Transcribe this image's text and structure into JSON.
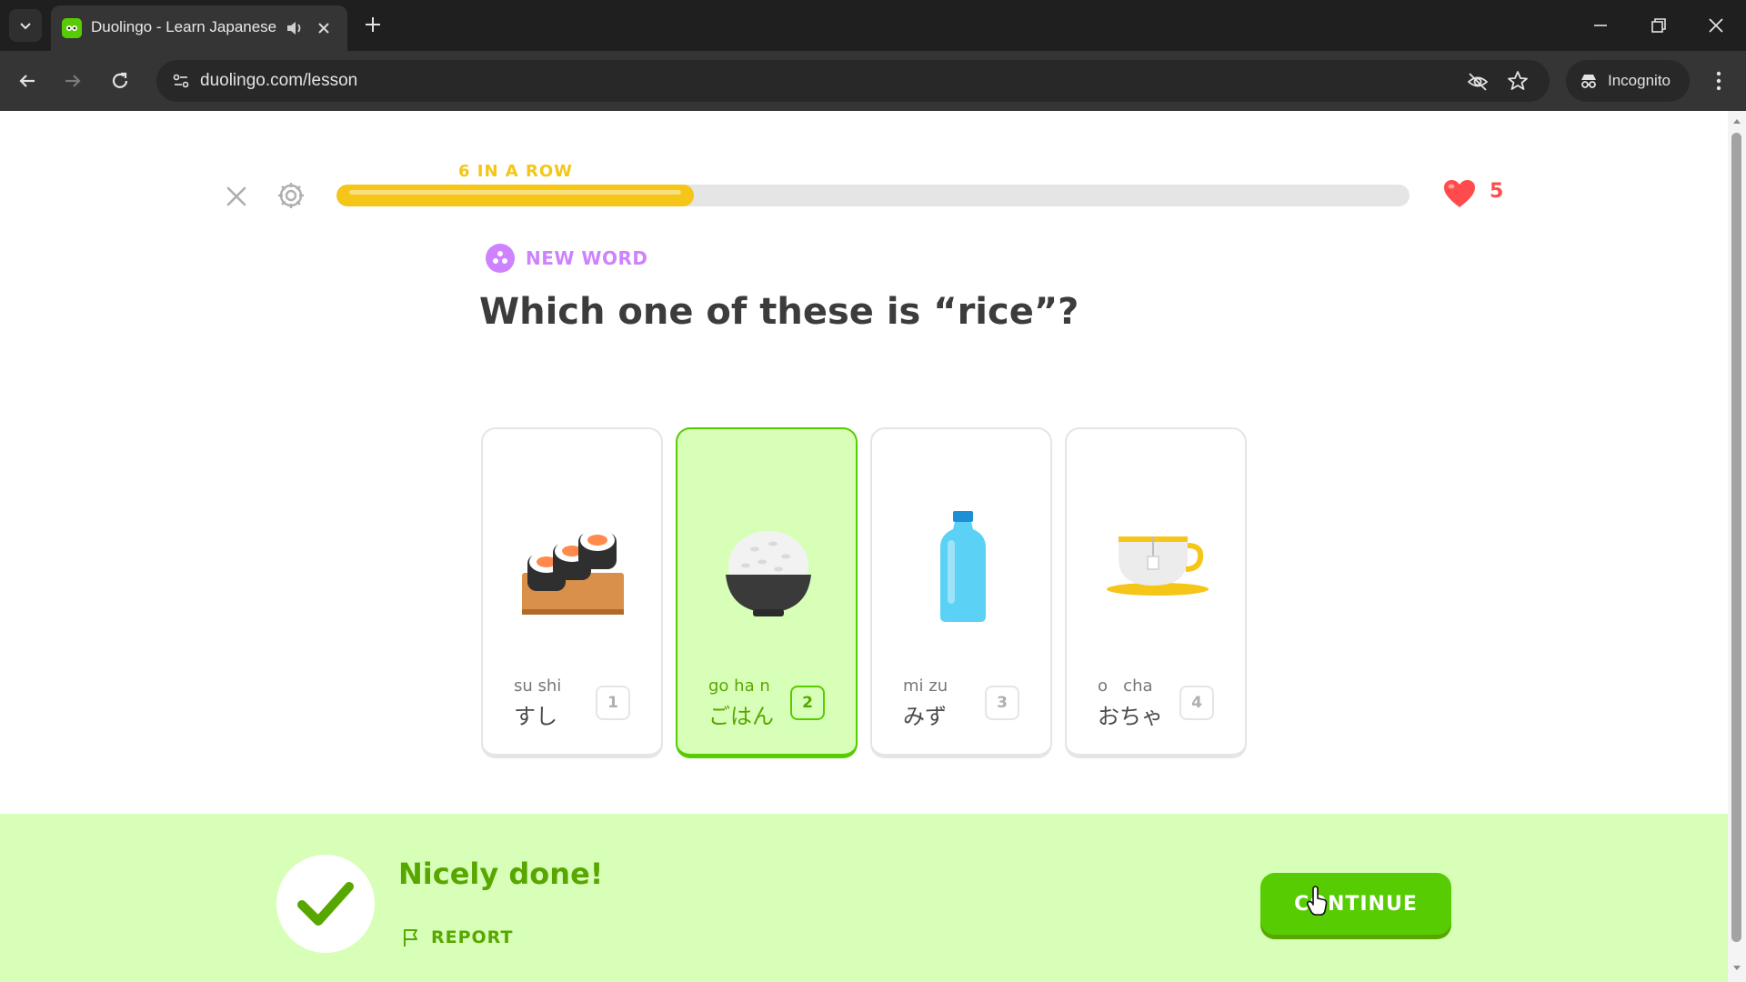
{
  "browser": {
    "tab_title": "Duolingo - Learn Japanese",
    "url": "duolingo.com/lesson",
    "profile_label": "Incognito"
  },
  "lesson": {
    "streak_label": "6 IN A ROW",
    "progress_fraction": 0.333,
    "hearts": "5"
  },
  "challenge": {
    "tag": "NEW WORD",
    "prompt": "Which one of these is “rice”?",
    "selected_index": 1,
    "choices": [
      {
        "romaji": "su shi",
        "kana": "すし",
        "number": "1",
        "image": "sushi-icon"
      },
      {
        "romaji": "go ha n",
        "kana": "ごはん",
        "number": "2",
        "image": "rice-bowl-icon"
      },
      {
        "romaji": "mi zu",
        "kana": "みず",
        "number": "3",
        "image": "water-bottle-icon"
      },
      {
        "romaji": "o   cha",
        "kana": "おちゃ",
        "number": "4",
        "image": "tea-cup-icon"
      }
    ]
  },
  "feedback": {
    "title": "Nicely done!",
    "report_label": "REPORT",
    "continue_label": "CONTINUE"
  },
  "colors": {
    "brand_green": "#58cc02",
    "streak_yellow": "#f5c518",
    "heart_red": "#ff4b4b",
    "new_word_purple": "#ce82ff",
    "feedback_bg": "#d7ffb8"
  }
}
